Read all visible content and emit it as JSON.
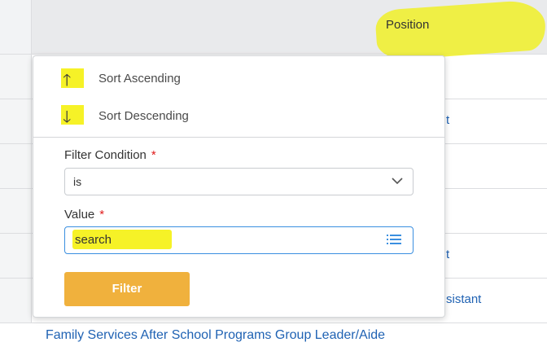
{
  "table": {
    "header": {
      "position_label": "Position"
    },
    "rows": [
      {
        "text": ""
      },
      {
        "text": "t"
      },
      {
        "text": ""
      },
      {
        "text": ""
      },
      {
        "text": "t"
      },
      {
        "text": "sistant"
      }
    ],
    "last_row_link": "Family Services After School Programs Group Leader/Aide"
  },
  "column_menu": {
    "sort_ascending": {
      "icon": "arrow-up-icon",
      "glyph": "🡑",
      "label": "Sort Ascending"
    },
    "sort_descending": {
      "icon": "arrow-down-icon",
      "glyph": "🡓",
      "label": "Sort Descending"
    },
    "filter_condition": {
      "label": "Filter Condition",
      "required_mark": "*",
      "value": "is"
    },
    "value_field": {
      "label": "Value",
      "required_mark": "*",
      "value": "search"
    },
    "filter_button": "Filter"
  },
  "colors": {
    "highlight": "#f6f227",
    "link": "#1f62b3",
    "filter_button": "#f0b13d",
    "required": "#e01b1b"
  }
}
